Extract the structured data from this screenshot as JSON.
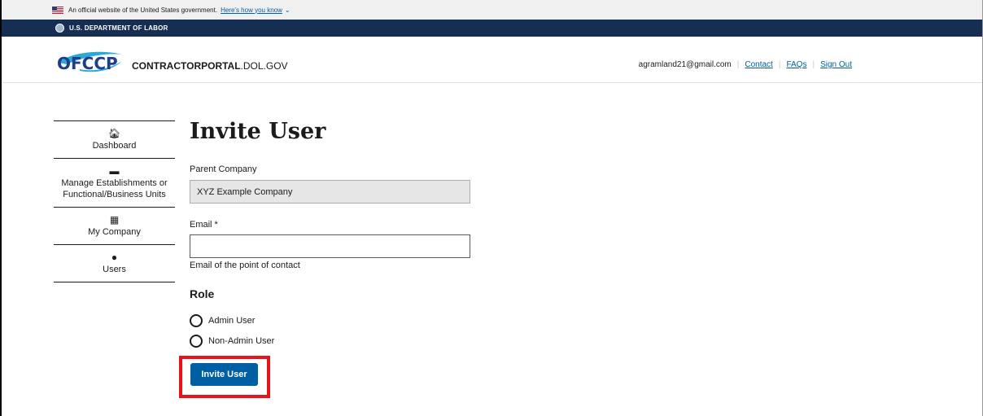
{
  "gov_banner": {
    "text": "An official website of the United States government.",
    "link": "Here's how you know"
  },
  "dol_bar": {
    "text": "U.S. DEPARTMENT OF LABOR"
  },
  "header": {
    "logo_text": "OFCCP",
    "site_name_bold": "CONTRACTORPORTAL",
    "site_name_rest": ".DOL.GOV",
    "email": "agramland21@gmail.com",
    "links": [
      "Contact",
      "FAQs",
      "Sign Out"
    ]
  },
  "sidenav": {
    "items": [
      {
        "label": "Dashboard",
        "icon": "home-icon"
      },
      {
        "label": "Manage Establishments or Functional/Business Units",
        "icon": "folder-icon"
      },
      {
        "label": "My Company",
        "icon": "building-icon"
      },
      {
        "label": "Users",
        "icon": "user-icon"
      }
    ]
  },
  "form": {
    "title": "Invite User",
    "parent_label": "Parent Company",
    "parent_value": "XYZ Example Company",
    "email_label": "Email *",
    "email_value": "",
    "email_hint": "Email of the point of contact",
    "role_heading": "Role",
    "roles": [
      "Admin User",
      "Non-Admin User"
    ],
    "submit_label": "Invite User"
  },
  "colors": {
    "dol_bar": "#162e51",
    "primary": "#005ea2",
    "highlight": "#e8121b"
  }
}
